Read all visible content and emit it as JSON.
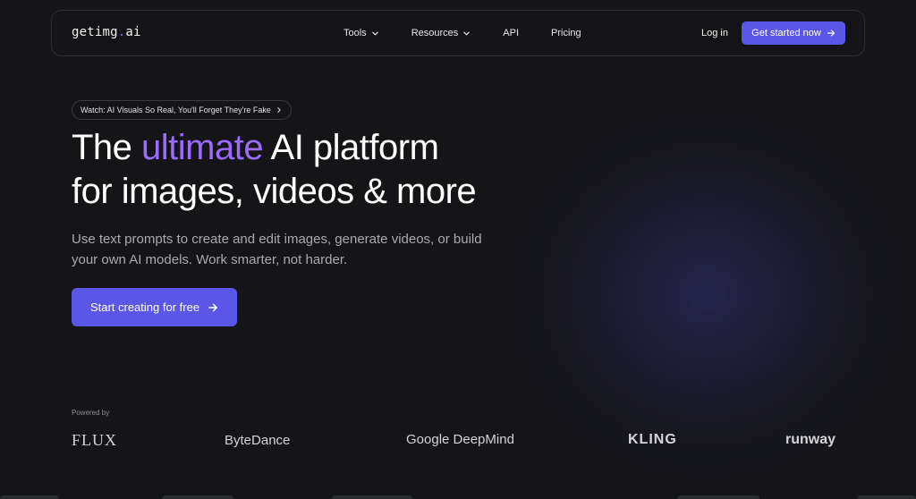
{
  "nav": {
    "logo_main": "getimg",
    "logo_dot": ".",
    "logo_tail": "ai",
    "links": [
      {
        "label": "Tools",
        "has_dropdown": true
      },
      {
        "label": "Resources",
        "has_dropdown": true
      },
      {
        "label": "API",
        "has_dropdown": false
      },
      {
        "label": "Pricing",
        "has_dropdown": false
      }
    ],
    "login": "Log in",
    "cta": "Get started now"
  },
  "hero": {
    "pill": "Watch: AI Visuals So Real, You'll Forget They're Fake",
    "headline_pre": "The ",
    "headline_accent": "ultimate",
    "headline_post": " AI platform",
    "headline_line2": "for images, videos & more",
    "subtitle": "Use text prompts to create and edit images, generate videos, or build your own AI models. Work smarter, not harder.",
    "cta": "Start creating for free"
  },
  "powered": {
    "label": "Powered by",
    "brands": [
      "FLUX",
      "ByteDance",
      "Google DeepMind",
      "KLING",
      "runway"
    ]
  },
  "colors": {
    "accent": "#5b57e6",
    "headline_accent": "#9a6bff",
    "background": "#151518"
  },
  "icons": [
    "chevron-down-icon",
    "arrow-right-icon",
    "chevron-right-icon"
  ]
}
